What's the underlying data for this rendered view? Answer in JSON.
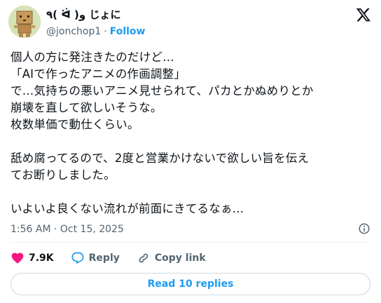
{
  "author": {
    "display_name": "٩( ᐛ )و じょに",
    "handle": "@jonchop1",
    "separator": "·",
    "follow_label": "Follow"
  },
  "tweet": {
    "text": "個人の方に発注きたのだけど…\n「AIで作ったアニメの作画調整」\nで…気持ちの悪いアニメ見せられて、パカとかぬめりとか\n崩壊を直して欲しいそうな。\n枚数単価で動仕くらい。\n\n舐め腐ってるので、2度と営業かけないで欲しい旨を伝え\nてお断りしました。\n\nいよいよ良くない流れが前面にきてるなぁ…",
    "timestamp": "1:56 AM · Oct 15, 2025"
  },
  "actions": {
    "like_count": "7.9K",
    "reply_label": "Reply",
    "copy_link_label": "Copy link"
  },
  "read_replies_label": "Read 10 replies",
  "colors": {
    "like": "#f91880",
    "accent": "#1d9bf0",
    "muted": "#536471"
  },
  "icons": [
    "avatar-cardboard-robot",
    "x-logo-icon",
    "info-icon",
    "heart-icon",
    "reply-bubble-icon",
    "link-icon"
  ]
}
